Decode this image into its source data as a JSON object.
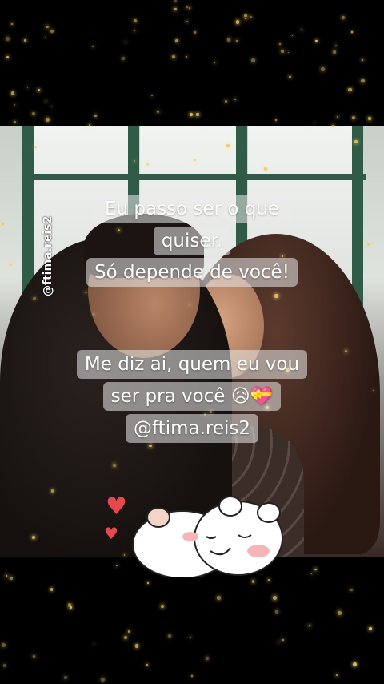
{
  "caption": {
    "line1": "Eu passo ser o que",
    "line2": "quiser.",
    "line3": "Só depende de você!",
    "line4": "Me diz ai, quem eu vou",
    "line5": "ser pra você 😥💝",
    "line6": "@ftima.reis2"
  },
  "watermark": "@ftima.reis2",
  "sticker": {
    "icon": "cuddling-bears-sticker",
    "hearts": [
      "♥",
      "♥"
    ]
  },
  "colors": {
    "background": "#000000",
    "sparkle": "#e8c867",
    "heart": "#e8474f"
  }
}
